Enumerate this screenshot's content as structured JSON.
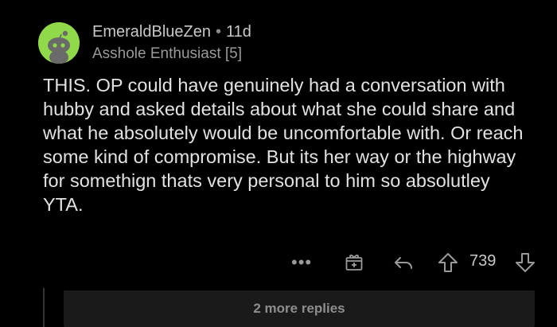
{
  "comment": {
    "author": "EmeraldBlueZen",
    "separator": "•",
    "age": "11d",
    "flair": "Asshole Enthusiast [5]",
    "body": "THIS. OP could have genuinely had a conversation with hubby and asked details about what she could share and what he absolutely would be uncomfortable with. Or reach some kind of compromise. But its her way or the highway for somethign thats very personal to him so absolutley YTA.",
    "avatar_color": "#8fd94a",
    "avatar_icon": "snoo-avatar-icon"
  },
  "actions": {
    "more_label": "•••",
    "more_icon": "more-options-icon",
    "award_icon": "award-gift-icon",
    "reply_icon": "reply-arrow-icon",
    "upvote_icon": "upvote-arrow-icon",
    "score": "739",
    "downvote_icon": "downvote-arrow-icon"
  },
  "replies": {
    "more_label": "2 more replies"
  },
  "colors": {
    "background": "#000000",
    "body_text": "#e2e2e2",
    "muted_text": "#9a9a9a",
    "reply_bar": "#1a1a1b"
  }
}
